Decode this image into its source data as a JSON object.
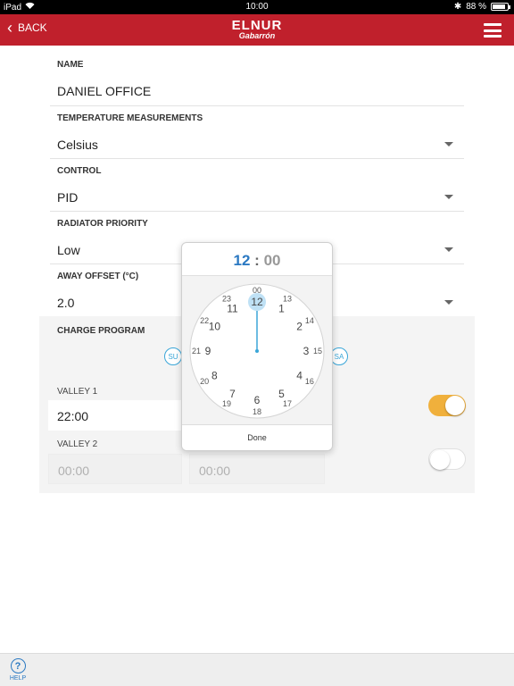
{
  "status": {
    "device": "iPad",
    "time": "10:00",
    "battery": "88 %",
    "battery_level": 0.88
  },
  "nav": {
    "back_label": "BACK",
    "logo_line1": "ELNUR",
    "logo_line2": "Gabarrón"
  },
  "fields": [
    {
      "label": "NAME",
      "value": "DANIEL OFFICE"
    },
    {
      "label": "TEMPERATURE MEASUREMENTS",
      "value": "Celsius"
    },
    {
      "label": "CONTROL",
      "value": "PID"
    },
    {
      "label": "RADIATOR PRIORITY",
      "value": "Low"
    },
    {
      "label": "AWAY OFFSET (°C)",
      "value": "2.0"
    }
  ],
  "charge": {
    "label": "CHARGE PROGRAM",
    "day_first": "SU",
    "day_last": "SA",
    "valley1": {
      "label": "VALLEY 1",
      "start": "22:00",
      "enabled": true
    },
    "valley2": {
      "label": "VALLEY 2",
      "start": "00:00",
      "end": "00:00",
      "enabled": false
    }
  },
  "picker": {
    "hour": "12",
    "separator": ":",
    "minute": "00",
    "selected_hour": 12,
    "inner_hours": [
      "12",
      "1",
      "2",
      "3",
      "4",
      "5",
      "6",
      "7",
      "8",
      "9",
      "10",
      "11"
    ],
    "outer_hours": [
      "00",
      "13",
      "14",
      "15",
      "16",
      "17",
      "18",
      "19",
      "20",
      "21",
      "22",
      "23"
    ],
    "done_label": "Done"
  },
  "help_label": "HELP",
  "colors": {
    "brand": "#c0202c",
    "accent_blue": "#3aa6d8",
    "toggle_on": "#f0b03c",
    "hand": "#3aa6d8"
  }
}
